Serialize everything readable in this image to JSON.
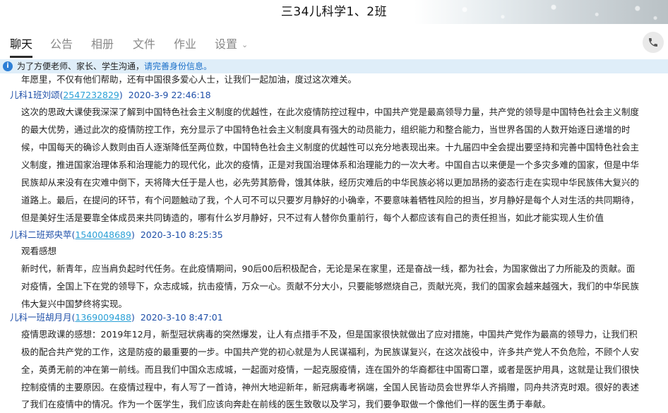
{
  "window": {
    "title": "三34儿科学1、2班"
  },
  "tabs": [
    {
      "label": "聊天",
      "active": true
    },
    {
      "label": "公告",
      "active": false
    },
    {
      "label": "相册",
      "active": false
    },
    {
      "label": "文件",
      "active": false
    },
    {
      "label": "作业",
      "active": false
    },
    {
      "label": "设置",
      "active": false
    }
  ],
  "icons": {
    "phone": "phone-icon",
    "info": "info-icon",
    "settings_dropdown": "chevron-down-icon"
  },
  "notice": {
    "text": "为了方便老师、家长、学生沟通，",
    "link": "请完善身份信息。"
  },
  "colors": {
    "sender_name": "#1f4fa8",
    "qq_link": "#2aa0d6",
    "notice_bg": "#dfeef9",
    "notice_link": "#1a6fc9",
    "info_icon": "#2d7fd6"
  },
  "messages": [
    {
      "continuation": true,
      "lines": [
        "年愿里，不仅有他们帮助，还有中国很多爱心人士，让我们一起加油，度过这次难关。"
      ]
    },
    {
      "name": "儿科1班刘颂",
      "qq": "2547232829",
      "time": "2020-3-9 22:46:18",
      "lines": [
        "这次的思政大课使我深深了解到中国特色社会主义制度的优越性，在此次疫情防控过程中，中国共产党是最高领导力量，共产党的领导是中国特色社会主义制度",
        "的最大优势，通过此次的疫情防控工作，充分显示了中国特色社会主义制度具有强大的动员能力，组织能力和整合能力，当世界各国的人数开始逐日递增的时",
        "候，中国每天的确诊人数则由百人逐渐降低至两位数，中国特色社会主义制度的优越性可以充分地表现出来。十九届四中全会提出要坚持和完善中国特色社会主",
        "义制度，推进国家治理体系和治理能力的现代化，此次的疫情，正是对我国治理体系和治理能力的一次大考。中国自古以来便是一个多灾多难的国家，但是中华",
        "民族却从来没有在灾难中倒下，天将降大任于是人也，必先劳其筋骨，饿其体肤，经历灾难后的中华民族必将以更加昂扬的姿态行走在实现中华民族伟大复兴的",
        "道路上。最后，在提问的环节，有个问题触动了我，个人可不可以只要岁月静好的小确幸，不要意味着牺牲风险的担当，岁月静好是每个人对生活的共同期待，",
        "但是美好生活是要靠全体成员来共同铸造的，哪有什么岁月静好，只不过有人替你负重前行，每个人都应该有自己的责任担当，如此才能实现人生价值"
      ]
    },
    {
      "name": "儿科二班郑央苹",
      "qq": "1540048689",
      "time": "2020-3-10 8:25:35",
      "lines": [
        "观看感想",
        "新时代，新青年，应当肩负起时代任务。在此疫情期间，90后00后积极配合，无论是呆在家里，还是奋战一线，都为社会，为国家做出了力所能及的贡献。面",
        "对疫情，全国上下在党的领导下，众志成城，抗击疫情，万众一心。贡献不分大小，只要能够燃烧自己，贡献光亮，我们的国家会越来越强大，我们的中华民族",
        "伟大复兴中国梦终将实现。"
      ]
    },
    {
      "name": "儿科一班胡月月",
      "qq": "1369009488",
      "time": "2020-3-10 8:47:01",
      "lines": [
        "疫情思政课的感想：2019年12月，新型冠状病毒的突然爆发，让人有点措手不及，但是国家很快就做出了应对措施，中国共产党作为最高的领导力，让我们积",
        "极的配合共产党的工作，这是防疫的最重要的一步。中国共产党的初心就是为人民谋福利，为民族谋复兴，在这次战役中，许多共产党人不负危险，不顾个人安",
        "全，英勇无前的冲在第一前线。而且我们中国众志成城，一起面对疫情，一起克服疫情，连在国外的华裔都往中国寄口罩，或者是医护用具，这就是让我们很快",
        "控制疫情的主要原因。在疫情过程中，有人写了一首诗，神州大地迎新年，新冠病毒考祸端，全国人民皆动员会世界华人齐捐赠，同舟共济克时艰。很好的表述",
        "了我们在疫情中的情况。作为一个医学生，我们应该向奔赴在前线的医生致敬以及学习，我们要争取做一个像他们一样的医生勇于奉献。"
      ]
    }
  ]
}
